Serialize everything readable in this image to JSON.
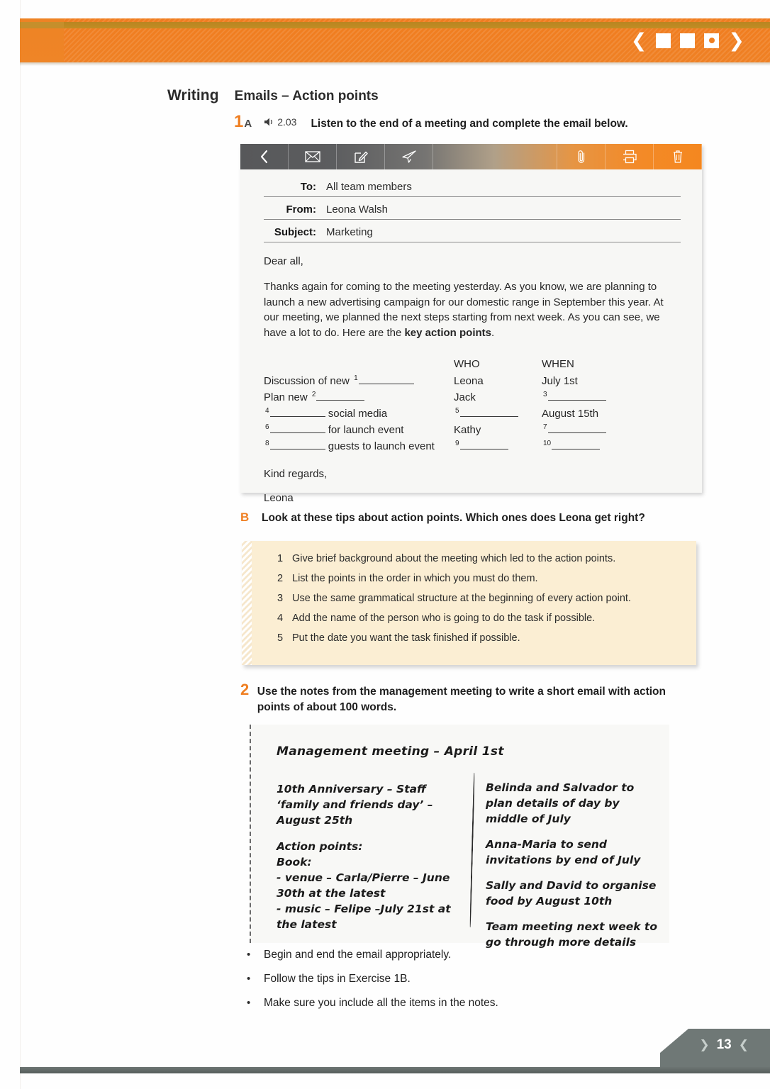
{
  "header": {
    "nav": {
      "prev_icon": "chevron-left-icon",
      "next_icon": "chevron-right-icon",
      "squares": [
        "square-blank",
        "square-blank",
        "square-dot"
      ]
    },
    "accent_color": "#ef7f22",
    "gold_color": "#c08d24"
  },
  "section": {
    "skill": "Writing",
    "topic": "Emails – Action points"
  },
  "exercise1": {
    "number": "1",
    "letter": "A",
    "audio_icon": "speaker-icon",
    "audio_track": "2.03",
    "instruction": "Listen to the end of a meeting and complete the email below."
  },
  "email": {
    "toolbar": [
      {
        "name": "back-icon",
        "label": "Back"
      },
      {
        "name": "envelope-icon",
        "label": "Mail"
      },
      {
        "name": "compose-icon",
        "label": "Compose"
      },
      {
        "name": "send-icon",
        "label": "Send"
      },
      {
        "name": "paperclip-icon",
        "label": "Attach"
      },
      {
        "name": "print-icon",
        "label": "Print"
      },
      {
        "name": "trash-icon",
        "label": "Delete"
      }
    ],
    "fields": [
      {
        "label": "To:",
        "value": "All team members"
      },
      {
        "label": "From:",
        "value": "Leona Walsh"
      },
      {
        "label": "Subject:",
        "value": "Marketing"
      }
    ],
    "greeting": "Dear all,",
    "paragraph_part1": "Thanks again for coming to the meeting yesterday. As you know, we are planning to launch a new advertising campaign for our domestic range in September this year. At our meeting, we planned the next steps starting from next week. As you can see, we have a lot to do. Here are the ",
    "paragraph_bold": "key action points",
    "paragraph_part2": ".",
    "table": {
      "headers": {
        "task": "",
        "who": "WHO",
        "when": "WHEN"
      },
      "rows": [
        {
          "task_before": "Discussion of new ",
          "task_gap": "1",
          "task_after": "",
          "who": "Leona",
          "who_gap": "",
          "when": "July 1st",
          "when_gap": ""
        },
        {
          "task_before": "Plan new ",
          "task_gap": "2",
          "task_after": "",
          "who": "Jack",
          "who_gap": "",
          "when": "",
          "when_gap": "3"
        },
        {
          "task_before": "",
          "task_gap": "4",
          "task_after": " social media",
          "who": "",
          "who_gap": "5",
          "when": "August 15th",
          "when_gap": ""
        },
        {
          "task_before": "",
          "task_gap": "6",
          "task_after": " for launch event",
          "who": "Kathy",
          "who_gap": "",
          "when": "",
          "when_gap": "7"
        },
        {
          "task_before": "",
          "task_gap": "8",
          "task_after": " guests to launch event",
          "who": "",
          "who_gap": "9",
          "when": "",
          "when_gap": "10"
        }
      ]
    },
    "closing": "Kind regards,",
    "signature": "Leona"
  },
  "exerciseB": {
    "letter": "B",
    "instruction": "Look at these tips about action points. Which ones does Leona get right?",
    "tips": [
      {
        "n": "1",
        "text": "Give brief background about the meeting which led to the action points."
      },
      {
        "n": "2",
        "text": "List the points in the order in which you must do them."
      },
      {
        "n": "3",
        "text": "Use the same grammatical structure at the beginning of every action point."
      },
      {
        "n": "4",
        "text": "Add the name of the person who is going to do the task if possible."
      },
      {
        "n": "5",
        "text": "Put the date you want the task finished if possible."
      }
    ]
  },
  "exercise2": {
    "number": "2",
    "instruction": "Use the notes from the management meeting to write a short email with action points of about 100 words."
  },
  "notes": {
    "title": "Management meeting – April 1st",
    "left": [
      "10th Anniversary – Staff ‘family and friends day’ – August 25th",
      "Action points:\nBook:\n-  venue – Carla/Pierre – June 30th at the latest\n-  music – Felipe –July 21st at the latest"
    ],
    "right": [
      "Belinda and Salvador to plan details of day by middle of July",
      "Anna-Maria to send invitations by end of July",
      "Sally and David to organise food by August 10th",
      "Team meeting next week to go through more details"
    ]
  },
  "bullets": [
    "Begin and end the email appropriately.",
    "Follow the tips in Exercise 1B.",
    "Make sure you include all the items in the notes."
  ],
  "footer": {
    "page_number": "13",
    "left_chevron": "chevron-right-icon",
    "right_chevron": "chevron-left-icon"
  }
}
